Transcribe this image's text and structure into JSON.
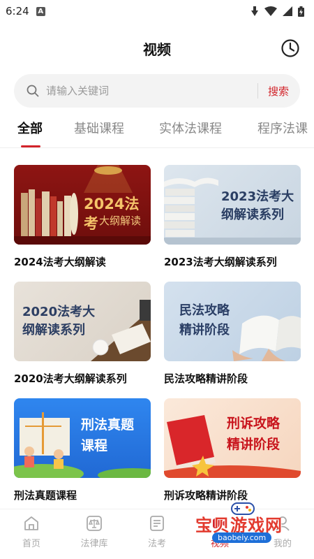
{
  "status_bar": {
    "time": "6:24",
    "indicator": "A"
  },
  "nav": {
    "title": "视频",
    "history_icon": "clock-icon"
  },
  "search": {
    "placeholder": "请输入关键词",
    "button_label": "搜索"
  },
  "tabs": [
    {
      "label": "全部",
      "active": true
    },
    {
      "label": "基础课程",
      "active": false
    },
    {
      "label": "实体法课程",
      "active": false
    },
    {
      "label": "程序法课",
      "active": false
    }
  ],
  "courses": [
    {
      "title": "2024法考大纲解读",
      "thumb_lines": [
        "2024法考",
        "大纲解读"
      ]
    },
    {
      "title": "2023法考大纲解读系列",
      "thumb_lines": [
        "2023法考大",
        "纲解读系列"
      ]
    },
    {
      "title": "2020法考大纲解读系列",
      "thumb_lines": [
        "2020法考大",
        "纲解读系列"
      ]
    },
    {
      "title": "民法攻略精讲阶段",
      "thumb_lines": [
        "民法攻略",
        "精讲阶段"
      ]
    },
    {
      "title": "刑法真题课程",
      "thumb_lines": [
        "刑法真题",
        "课程"
      ]
    },
    {
      "title": "刑诉攻略精讲阶段",
      "thumb_lines": [
        "刑诉攻略",
        "精讲阶段"
      ]
    }
  ],
  "bottom_nav": [
    {
      "label": "首页",
      "icon": "home-icon"
    },
    {
      "label": "法律库",
      "icon": "scale-icon"
    },
    {
      "label": "法考",
      "icon": "document-icon"
    },
    {
      "label": "视频",
      "icon": "video-icon"
    },
    {
      "label": "我的",
      "icon": "user-icon"
    }
  ],
  "watermark": {
    "text": "宝贝游戏网",
    "url": "baobeiy.com"
  },
  "colors": {
    "accent": "#d2232a"
  }
}
